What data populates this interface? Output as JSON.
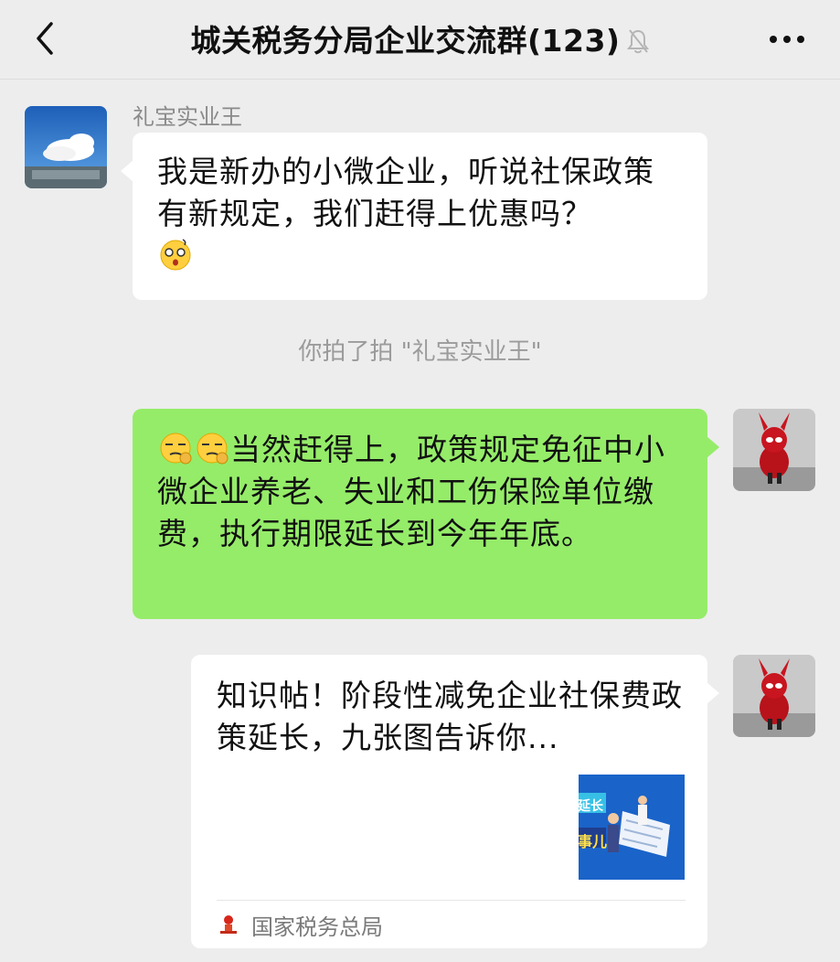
{
  "header": {
    "back_icon": "chevron-left-icon",
    "title": "城关税务分局企业交流群(123)",
    "mute_icon": "bell-mute-icon",
    "more_icon": "more-dots-icon"
  },
  "messages": [
    {
      "sender": "礼宝实业王",
      "text": "我是新办的小微企业，听说社保政策有新规定，我们赶得上优惠吗？",
      "emoji": "dizzy-face-emoji"
    },
    {
      "system": "你拍了拍 \"礼宝实业王\""
    },
    {
      "emoji": "smirk-ok-emoji",
      "text": "当然赶得上，政策规定免征中小微企业养老、失业和工伤保险单位缴费，执行期限延长到今年年底。"
    },
    {
      "card_title": "知识帖！阶段性减免企业社保费政策延长，九张图告诉你...",
      "thumb_text_1": "延长",
      "thumb_text_2": "事儿",
      "source": "国家税务总局"
    }
  ],
  "colors": {
    "background": "#ededed",
    "bubble_self": "#95ec69",
    "bubble_other": "#ffffff"
  }
}
